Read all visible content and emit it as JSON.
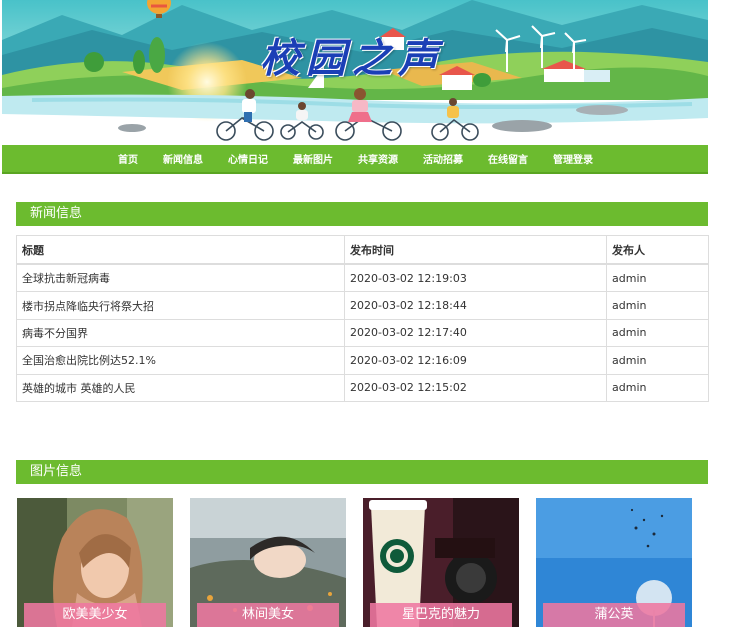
{
  "banner": {
    "site_title": "校园之声"
  },
  "nav": {
    "items": [
      {
        "label": "首页"
      },
      {
        "label": "新闻信息"
      },
      {
        "label": "心情日记"
      },
      {
        "label": "最新图片"
      },
      {
        "label": "共享资源"
      },
      {
        "label": "活动招募"
      },
      {
        "label": "在线留言"
      },
      {
        "label": "管理登录"
      }
    ]
  },
  "news": {
    "section_title": "新闻信息",
    "columns": [
      "标题",
      "发布时间",
      "发布人"
    ],
    "rows": [
      {
        "title": "全球抗击新冠病毒",
        "time": "2020-03-02 12:19:03",
        "author": "admin"
      },
      {
        "title": "楼市拐点降临央行将祭大招",
        "time": "2020-03-02 12:18:44",
        "author": "admin"
      },
      {
        "title": "病毒不分国界",
        "time": "2020-03-02 12:17:40",
        "author": "admin"
      },
      {
        "title": "全国治愈出院比例达52.1%",
        "time": "2020-03-02 12:16:09",
        "author": "admin"
      },
      {
        "title": "英雄的城市 英雄的人民",
        "time": "2020-03-02 12:15:02",
        "author": "admin"
      }
    ]
  },
  "pictures": {
    "section_title": "图片信息",
    "items": [
      {
        "label": "欧美美少女"
      },
      {
        "label": "林间美女"
      },
      {
        "label": "星巴克的魅力"
      },
      {
        "label": "蒲公英"
      }
    ]
  },
  "colors": {
    "accent_green": "#6cbb2f",
    "label_pink": "#ee78a0",
    "title_blue": "#1b3fb6"
  }
}
